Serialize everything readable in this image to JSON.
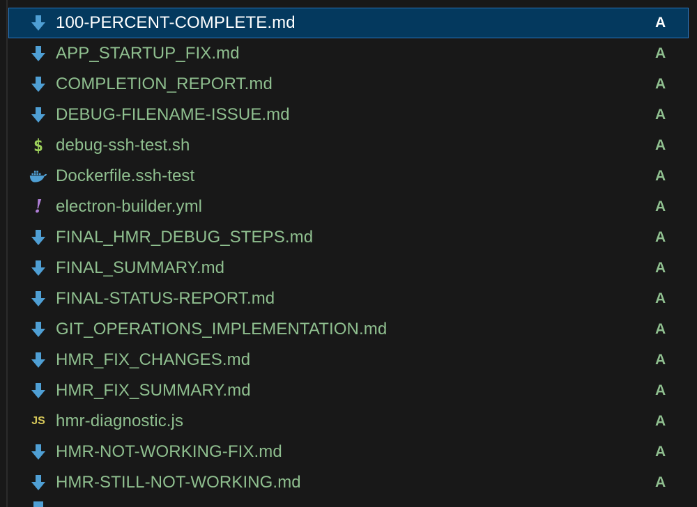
{
  "files": [
    {
      "name": "100-PERCENT-COMPLETE.md",
      "status": "A",
      "icon": "markdown-download-icon",
      "selected": true
    },
    {
      "name": "APP_STARTUP_FIX.md",
      "status": "A",
      "icon": "markdown-download-icon"
    },
    {
      "name": "COMPLETION_REPORT.md",
      "status": "A",
      "icon": "markdown-download-icon"
    },
    {
      "name": "DEBUG-FILENAME-ISSUE.md",
      "status": "A",
      "icon": "markdown-download-icon"
    },
    {
      "name": "debug-ssh-test.sh",
      "status": "A",
      "icon": "shell-dollar-icon"
    },
    {
      "name": "Dockerfile.ssh-test",
      "status": "A",
      "icon": "docker-whale-icon"
    },
    {
      "name": "electron-builder.yml",
      "status": "A",
      "icon": "yaml-exclamation-icon"
    },
    {
      "name": "FINAL_HMR_DEBUG_STEPS.md",
      "status": "A",
      "icon": "markdown-download-icon"
    },
    {
      "name": "FINAL_SUMMARY.md",
      "status": "A",
      "icon": "markdown-download-icon"
    },
    {
      "name": "FINAL-STATUS-REPORT.md",
      "status": "A",
      "icon": "markdown-download-icon"
    },
    {
      "name": "GIT_OPERATIONS_IMPLEMENTATION.md",
      "status": "A",
      "icon": "markdown-download-icon"
    },
    {
      "name": "HMR_FIX_CHANGES.md",
      "status": "A",
      "icon": "markdown-download-icon"
    },
    {
      "name": "HMR_FIX_SUMMARY.md",
      "status": "A",
      "icon": "markdown-download-icon"
    },
    {
      "name": "hmr-diagnostic.js",
      "status": "A",
      "icon": "javascript-icon"
    },
    {
      "name": "HMR-NOT-WORKING-FIX.md",
      "status": "A",
      "icon": "markdown-download-icon"
    },
    {
      "name": "HMR-STILL-NOT-WORKING.md",
      "status": "A",
      "icon": "markdown-download-icon"
    }
  ],
  "glyphs": {
    "shell": "$",
    "yaml": "!",
    "js": "JS"
  },
  "colors": {
    "background": "#181818",
    "added_text": "#8fbf8f",
    "selection_bg": "#04395e",
    "selection_border": "#2b79c2",
    "markdown_icon": "#4f9fd4",
    "docker_icon": "#4f9fd4",
    "shell_icon": "#9ccf5b",
    "yaml_icon": "#b07fd8",
    "js_icon": "#d8c95a"
  }
}
